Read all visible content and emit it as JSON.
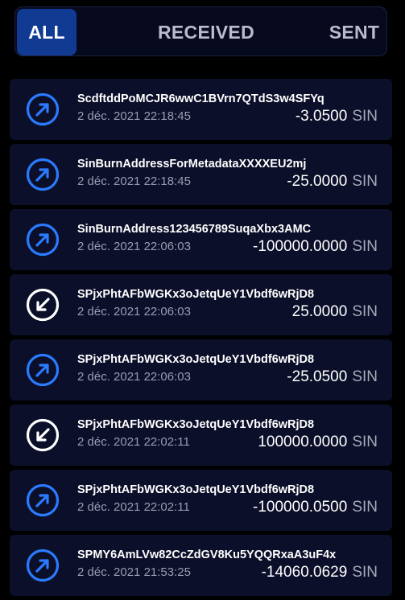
{
  "tabs": {
    "all": "ALL",
    "received": "RECEIVED",
    "sent": "SENT"
  },
  "colors": {
    "accent": "#113a93",
    "sent_icon": "#2a7bff",
    "received_icon": "#ffffff",
    "row_bg": "#0b0f29"
  },
  "transactions": [
    {
      "type": "sent",
      "icon": "arrow-up-right-icon",
      "address": "ScdftddPoMCJR6wwC1BVrn7QTdS3w4SFYq",
      "date": "2 déc. 2021 22:18:45",
      "amount": "-3.0500",
      "currency": "SIN"
    },
    {
      "type": "sent",
      "icon": "arrow-up-right-icon",
      "address": "SinBurnAddressForMetadataXXXXEU2mj",
      "date": "2 déc. 2021 22:18:45",
      "amount": "-25.0000",
      "currency": "SIN"
    },
    {
      "type": "sent",
      "icon": "arrow-up-right-icon",
      "address": "SinBurnAddress123456789SuqaXbx3AMC",
      "date": "2 déc. 2021 22:06:03",
      "amount": "-100000.0000",
      "currency": "SIN"
    },
    {
      "type": "received",
      "icon": "arrow-down-left-icon",
      "address": "SPjxPhtAFbWGKx3oJetqUeY1Vbdf6wRjD8",
      "date": "2 déc. 2021 22:06:03",
      "amount": "25.0000",
      "currency": "SIN"
    },
    {
      "type": "sent",
      "icon": "arrow-up-right-icon",
      "address": "SPjxPhtAFbWGKx3oJetqUeY1Vbdf6wRjD8",
      "date": "2 déc. 2021 22:06:03",
      "amount": "-25.0500",
      "currency": "SIN"
    },
    {
      "type": "received",
      "icon": "arrow-down-left-icon",
      "address": "SPjxPhtAFbWGKx3oJetqUeY1Vbdf6wRjD8",
      "date": "2 déc. 2021 22:02:11",
      "amount": "100000.0000",
      "currency": "SIN"
    },
    {
      "type": "sent",
      "icon": "arrow-up-right-icon",
      "address": "SPjxPhtAFbWGKx3oJetqUeY1Vbdf6wRjD8",
      "date": "2 déc. 2021 22:02:11",
      "amount": "-100000.0500",
      "currency": "SIN"
    },
    {
      "type": "sent",
      "icon": "arrow-up-right-icon",
      "address": "SPMY6AmLVw82CcZdGV8Ku5YQQRxaA3uF4x",
      "date": "2 déc. 2021 21:53:25",
      "amount": "-14060.0629",
      "currency": "SIN"
    }
  ]
}
